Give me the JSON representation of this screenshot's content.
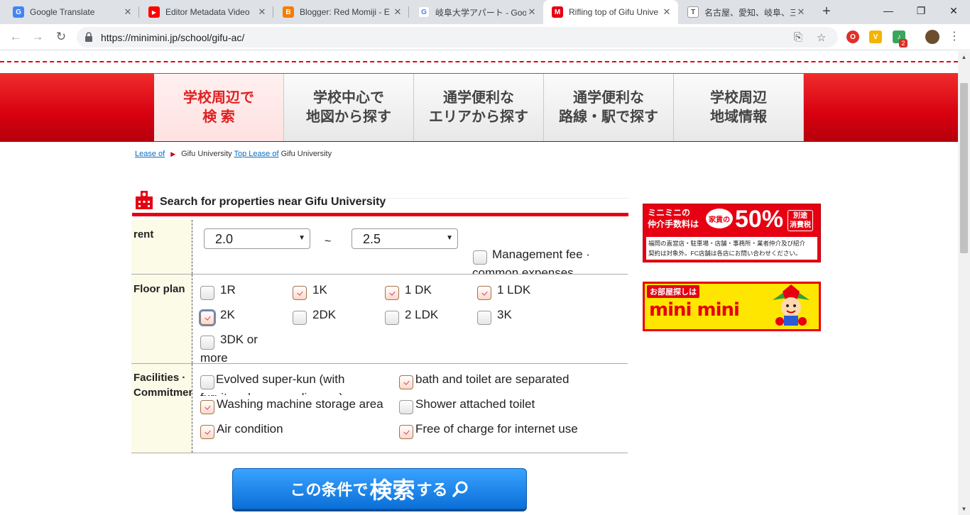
{
  "browser": {
    "tabs": [
      {
        "title": "Google Translate",
        "icon": "google-translate-icon",
        "color": "#4285f4",
        "glyph": "G"
      },
      {
        "title": "Editor Metadata Video",
        "icon": "youtube-icon",
        "color": "#ff0000",
        "glyph": "▶"
      },
      {
        "title": "Blogger: Red Momiji - E",
        "icon": "blogger-icon",
        "color": "#f57d00",
        "glyph": "B"
      },
      {
        "title": "岐阜大学アパート - Goog",
        "icon": "google-icon",
        "color": "#4285f4",
        "glyph": "G"
      },
      {
        "title": "Rifling top of Gifu Unive",
        "icon": "minimini-icon",
        "color": "#e60012",
        "glyph": "M"
      },
      {
        "title": "名古屋、愛知、岐阜、三重",
        "icon": "shirt-icon",
        "color": "#777777",
        "glyph": "T"
      }
    ],
    "url": "https://minimini.jp/school/gifu-ac/",
    "extension_badge": "2"
  },
  "nav": {
    "items": [
      {
        "line1": "学校周辺で",
        "line2": "検 索",
        "active": true
      },
      {
        "line1": "学校中心で",
        "line2": "地図から探す",
        "active": false
      },
      {
        "line1": "通学便利な",
        "line2": "エリアから探す",
        "active": false
      },
      {
        "line1": "通学便利な",
        "line2": "路線・駅で探す",
        "active": false
      },
      {
        "line1": "学校周辺",
        "line2": "地域情報",
        "active": false
      }
    ]
  },
  "breadcrumb": {
    "link1": "Lease of",
    "text1": "Gifu University",
    "link2": "Top Lease of",
    "text2": "Gifu University"
  },
  "section_title": "Search for properties near Gifu University",
  "form": {
    "rent": {
      "label": "rent",
      "min": "2.0",
      "max": "2.5",
      "tilde": "~",
      "mgmt_fee_label": "Management fee · common expenses"
    },
    "floor_plan": {
      "label": "Floor plan",
      "options": [
        "1R",
        "1K",
        "1 DK",
        "1 LDK",
        "2K",
        "2DK",
        "2 LDK",
        "3K",
        "3DK or more"
      ]
    },
    "facilities": {
      "label": "Facilities · Commitment",
      "options": [
        "Evolved super-kun (with furniture home appliances)",
        "bath and toilet are separated",
        "Washing machine storage area",
        "Shower attached toilet",
        "Air condition",
        "Free of charge for internet use"
      ]
    }
  },
  "search_button": {
    "part1": "この条件で",
    "part2": "検索",
    "part3": "する"
  },
  "banners": {
    "banner1": {
      "line1": "ミニミニの",
      "line2": "仲介手数料は",
      "badge": "家賃の",
      "big": "50%",
      "tax1": "別途",
      "tax2": "消費税",
      "note1": "福岡の直営店・駐車場・店舗・事務所・業者仲介及び紹介",
      "note2": "契約は対象外。FC店舗は各店にお問い合わせください。"
    },
    "banner2": {
      "caption": "お部屋探しは",
      "brand": "mini mini"
    }
  },
  "colors": {
    "brand_red": "#e60012",
    "button_blue": "#1a86ee",
    "label_bg": "#fcfbe8",
    "link": "#0a6dc2"
  }
}
